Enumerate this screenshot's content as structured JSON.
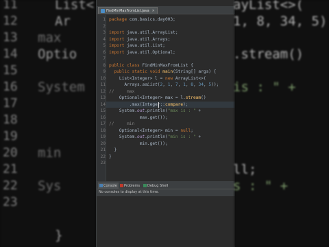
{
  "editor": {
    "file_tab": "FindMinMaxFromList.java",
    "lines": [
      {
        "n": "1",
        "html": "<span class='kw'>package</span> com.basics.day003;"
      },
      {
        "n": "2",
        "html": ""
      },
      {
        "n": "3",
        "html": "<span class='kw'>import</span> java.util.ArrayList;"
      },
      {
        "n": "4",
        "html": "<span class='kw'>import</span> java.util.Arrays;"
      },
      {
        "n": "5",
        "html": "<span class='kw'>import</span> java.util.List;"
      },
      {
        "n": "6",
        "html": "<span class='kw'>import</span> java.util.Optional;"
      },
      {
        "n": "7",
        "html": ""
      },
      {
        "n": "8",
        "html": "<span class='kw'>public class</span> FindMinMaxFromList {"
      },
      {
        "n": "9",
        "html": "  <span class='kw'>public static void</span> <span class='cls'>main</span>(String[] args) {"
      },
      {
        "n": "10",
        "html": "    List&lt;Integer&gt; l = <span class='kw'>new</span> ArrayList&lt;&gt;("
      },
      {
        "n": "11",
        "html": "      Arrays.<span class='it'>asList</span>(<span class='num'>2</span>, <span class='num'>1</span>, <span class='num'>7</span>, <span class='num'>1</span>, <span class='num'>8</span>, <span class='num'>34</span>, <span class='num'>5</span>));"
      },
      {
        "n": "12",
        "html": "<span class='cmt'>//     max</span>"
      },
      {
        "n": "13",
        "html": "    Optional&lt;Integer&gt; max = l.<span class='cls'>stream</span>()"
      },
      {
        "n": "14",
        "html": "        .max(Integer::<span class='cls'>compare</span>);"
      },
      {
        "n": "15",
        "html": "    System.<span class='typ it'>out</span>.println(<span class='str'>\"max is : \"</span> +"
      },
      {
        "n": "16",
        "html": "            max.get());"
      },
      {
        "n": "17",
        "html": "<span class='cmt'>//     min</span>"
      },
      {
        "n": "18",
        "html": "    Optional&lt;Integer&gt; min = <span class='kw'>null</span>;"
      },
      {
        "n": "19",
        "html": "    System.<span class='typ it'>out</span>.println(<span class='str'>\"min is : \"</span> +"
      },
      {
        "n": "20",
        "html": "            min.get());"
      },
      {
        "n": "21",
        "html": "  }"
      },
      {
        "n": "22",
        "html": "}"
      },
      {
        "n": "23",
        "html": ""
      }
    ]
  },
  "console": {
    "tabs": [
      {
        "label": "Console",
        "active": true,
        "icon": "console-icon",
        "color": "#4a7fb0"
      },
      {
        "label": "Problems",
        "active": false,
        "icon": "problems-icon",
        "color": "#c0392b"
      },
      {
        "label": "Debug Shell",
        "active": false,
        "icon": "debug-shell-icon",
        "color": "#3a8a5a"
      }
    ],
    "message": "No consoles to display at this time."
  },
  "background": {
    "left_lines": [
      "List<",
      "Ar",
      "max",
      "Optio",
      "",
      "System",
      "",
      "",
      "",
      "min",
      "",
      "Sys",
      "",
      "",
      "}"
    ],
    "left_nums": [
      "11",
      "12",
      "13",
      "14",
      "15",
      "16",
      "17",
      "18",
      "19",
      "20",
      "21",
      "22",
      "23"
    ],
    "right_lines": [
      "ayList<>(",
      "1, 8, 34, 5)",
      "",
      ".stream()",
      "",
      "is : \" +",
      "",
      "",
      "",
      "",
      "ll;",
      "s : \" +",
      "",
      "",
      ""
    ]
  },
  "colors": {
    "editor_bg": "#2b2b2b",
    "keyword": "#cc7832",
    "string": "#6a8759",
    "comment": "#808080"
  }
}
